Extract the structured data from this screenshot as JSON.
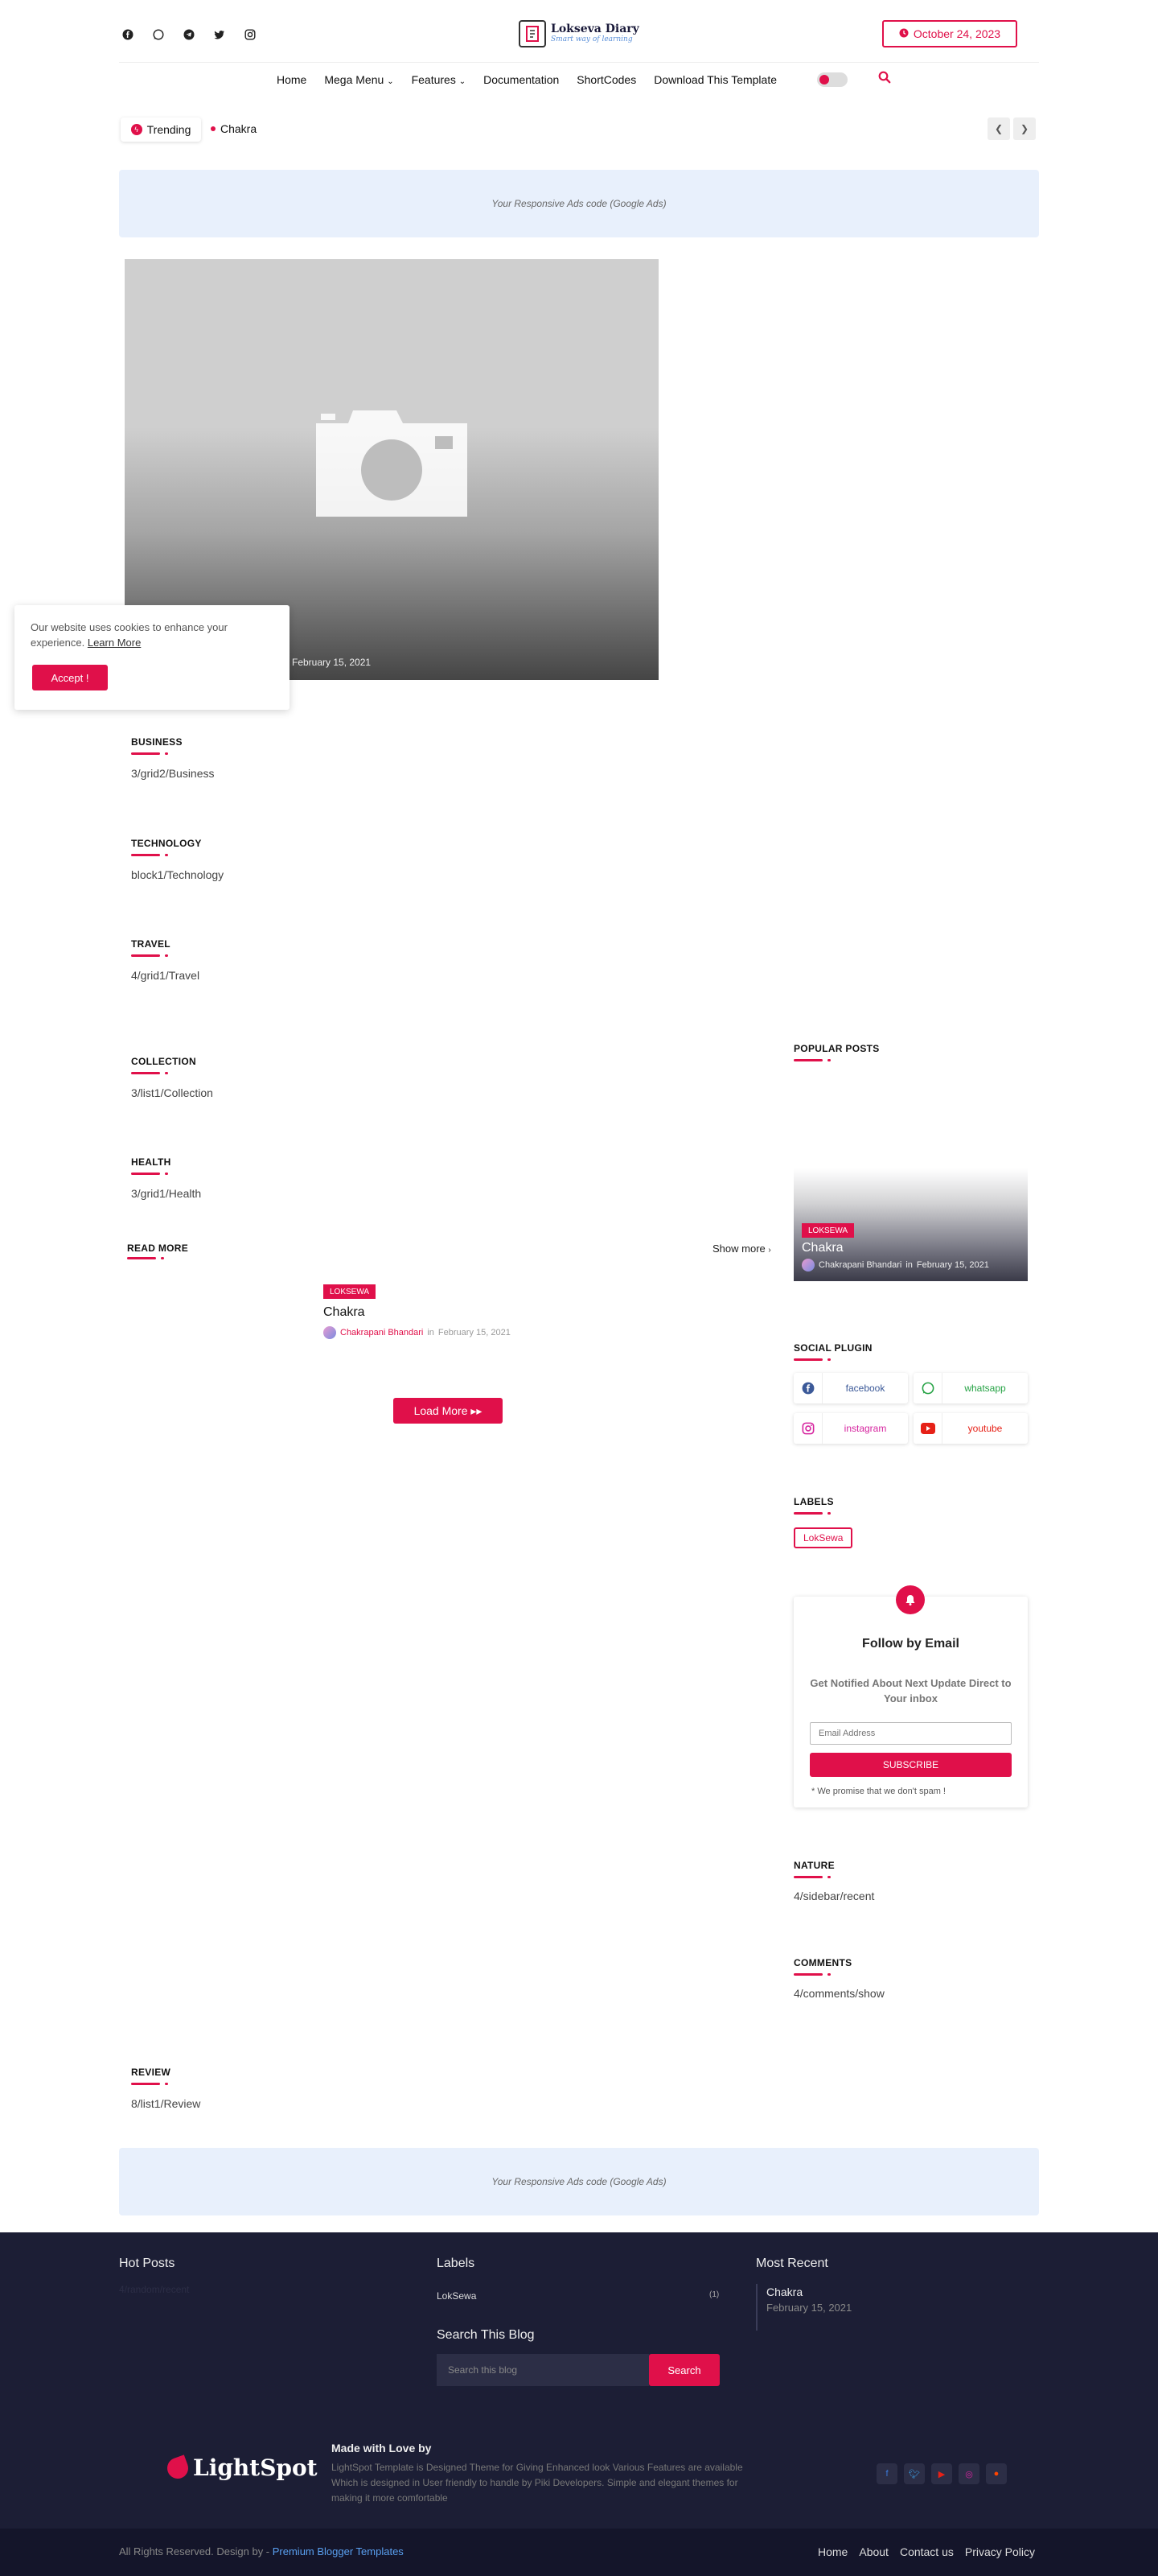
{
  "site": {
    "title": "Lokseva Diary",
    "tagline": "Smart way of learning",
    "date": "October 24, 2023"
  },
  "header": {
    "social_icons": [
      "facebook-icon",
      "whatsapp-icon",
      "telegram-icon",
      "twitter-icon",
      "instagram-icon"
    ],
    "nav": [
      "Home",
      "Mega Menu",
      "Features",
      "Documentation",
      "ShortCodes",
      "Download This Template"
    ]
  },
  "trending": {
    "label": "Trending",
    "item": "Chakra"
  },
  "ads": {
    "text": "Your Responsive Ads code (Google Ads)"
  },
  "featured": {
    "date": "February 15, 2021"
  },
  "cookie": {
    "message": "Our website uses cookies to enhance your experience.",
    "link": "Learn More",
    "button": "Accept !"
  },
  "sections": [
    {
      "title": "BUSINESS",
      "text": "3/grid2/Business"
    },
    {
      "title": "TECHNOLOGY",
      "text": "block1/Technology"
    },
    {
      "title": "TRAVEL",
      "text": "4/grid1/Travel"
    },
    {
      "title": "COLLECTION",
      "text": "3/list1/Collection"
    },
    {
      "title": "HEALTH",
      "text": "3/grid1/Health"
    },
    {
      "title": "REVIEW",
      "text": "8/list1/Review"
    }
  ],
  "read_more": {
    "title": "READ MORE",
    "show_more": "Show more",
    "post": {
      "tag": "LOKSEWA",
      "title": "Chakra",
      "author": "Chakrapani Bhandari",
      "in": "in",
      "date": "February 15, 2021"
    },
    "load_more": "Load More ▸▸"
  },
  "sidebar": {
    "popular_title": "POPULAR POSTS",
    "popular_post": {
      "tag": "LOKSEWA",
      "title": "Chakra",
      "author": "Chakrapani Bhandari",
      "in": "in",
      "date": "February 15, 2021"
    },
    "social_title": "SOCIAL PLUGIN",
    "social": [
      {
        "name": "facebook",
        "color": "#3b5998",
        "icon": "facebook-icon"
      },
      {
        "name": "whatsapp",
        "color": "#25a244",
        "icon": "whatsapp-icon"
      },
      {
        "name": "instagram",
        "color": "#d6249f",
        "icon": "instagram-icon"
      },
      {
        "name": "youtube",
        "color": "#e62117",
        "icon": "youtube-icon"
      }
    ],
    "labels_title": "LABELS",
    "label": "LokSewa",
    "follow": {
      "title": "Follow by Email",
      "subtitle": "Get Notified About Next Update Direct to Your inbox",
      "placeholder": "Email Address",
      "button": "SUBSCRIBE",
      "note": "* We promise that we don't spam !"
    },
    "nature_title": "NATURE",
    "nature_text": "4/sidebar/recent",
    "comments_title": "COMMENTS",
    "comments_text": "4/comments/show"
  },
  "footer": {
    "hot_posts_title": "Hot Posts",
    "hot_posts_text": "4/random/recent",
    "labels_title": "Labels",
    "label_name": "LokSewa",
    "label_count": "(1)",
    "search_title": "Search This Blog",
    "search_placeholder": "Search this blog",
    "search_button": "Search",
    "recent_title": "Most Recent",
    "recent_post": "Chakra",
    "recent_date": "February 15, 2021",
    "brand": "LightSpot",
    "made_title": "Made with Love by",
    "made_text": "LightSpot Template is Designed Theme for Giving Enhanced look Various Features are available Which is designed in User friendly to handle by Piki Developers. Simple and elegant themes for making it more comfortable",
    "social_icons": [
      "facebook-icon",
      "twitter-icon",
      "youtube-icon",
      "instagram-icon",
      "reddit-icon"
    ]
  },
  "bottom": {
    "left": "All Rights Reserved. Design by - ",
    "left_link": "Premium Blogger Templates",
    "links": [
      "Home",
      "About",
      "Contact us",
      "Privacy Policy"
    ]
  },
  "colors": {
    "accent": "#e0104a",
    "footer_bg": "#1c1e35",
    "ads_bg": "#e8f0fc"
  }
}
